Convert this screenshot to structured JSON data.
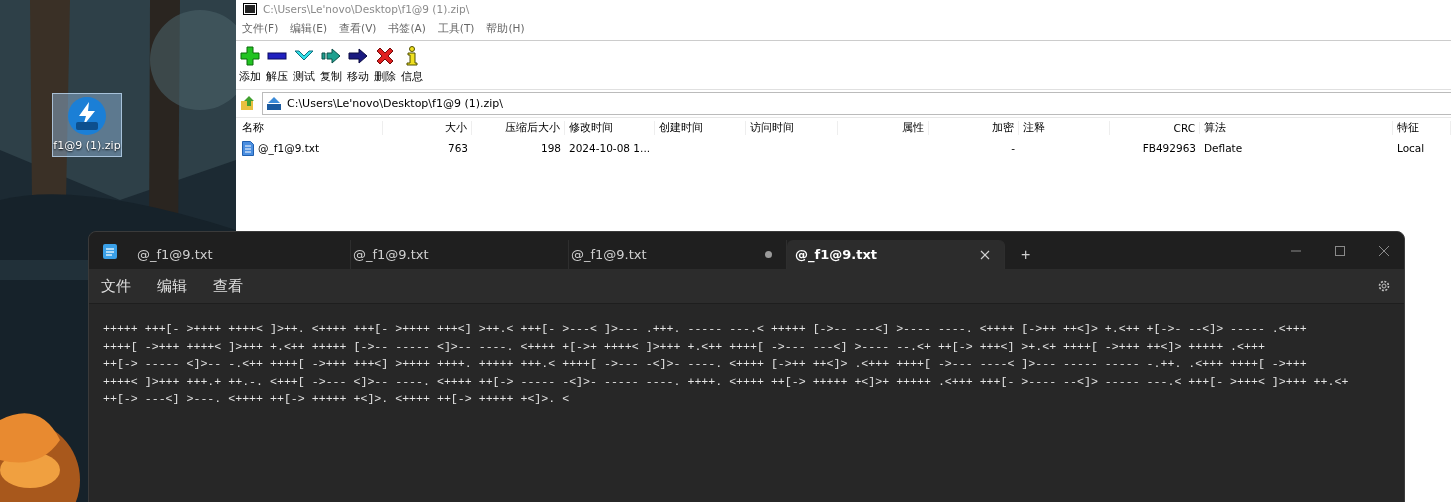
{
  "desktop": {
    "icon": {
      "label": "f1@9 (1).zip",
      "selected": true
    }
  },
  "archive_window": {
    "title": "C:\\Users\\Le'novo\\Desktop\\f1@9 (1).zip\\",
    "menu": [
      "文件(F)",
      "编辑(E)",
      "查看(V)",
      "书签(A)",
      "工具(T)",
      "帮助(H)"
    ],
    "toolbar": [
      {
        "label": "添加",
        "kind": "add"
      },
      {
        "label": "解压",
        "kind": "extract"
      },
      {
        "label": "测试",
        "kind": "test"
      },
      {
        "label": "复制",
        "kind": "copy"
      },
      {
        "label": "移动",
        "kind": "move"
      },
      {
        "label": "删除",
        "kind": "delete"
      },
      {
        "label": "信息",
        "kind": "info"
      }
    ],
    "address": "C:\\Users\\Le'novo\\Desktop\\f1@9 (1).zip\\",
    "columns": [
      "名称",
      "大小",
      "压缩后大小",
      "修改时间",
      "创建时间",
      "访问时间",
      "属性",
      "加密",
      "注释",
      "CRC",
      "算法",
      "特征"
    ],
    "rows": [
      {
        "name": "@_f1@9.txt",
        "size": "763",
        "packed_size": "198",
        "modified": "2024-10-08 1...",
        "encrypted": "-",
        "crc": "FB492963",
        "method": "Deflate",
        "characteristics": "Local"
      }
    ]
  },
  "editor": {
    "tabs": [
      {
        "label": "@_f1@9.txt",
        "selected": false,
        "modified": false
      },
      {
        "label": "@_f1@9.txt",
        "selected": false,
        "modified": false
      },
      {
        "label": "@_f1@9.txt",
        "selected": false,
        "modified": true
      },
      {
        "label": "@_f1@9.txt",
        "selected": true,
        "modified": false
      }
    ],
    "new_tab": "+",
    "menu": [
      "文件",
      "编辑",
      "查看"
    ],
    "lines": [
      "+++++ +++[- >++++ ++++< ]>++. <++++ +++[- >++++ +++<] >++.< +++[- >---< ]>--- .+++. ----- ---.< +++++ [->-- ---<] >---- ----. <++++ [->++ ++<]> +.<++ +[->- --<]> ----- .<+++",
      "++++[ ->+++ ++++< ]>+++ +.<++ +++++ [->-- ----- <]>-- ----. <++++ +[->+ ++++< ]>+++ +.<++ ++++[ ->--- ---<] >---- --.<+ ++[-> +++<] >+.<+ ++++[ ->+++ ++<]> +++++ .<+++",
      "++[-> ----- <]>-- -.<++ ++++[ ->+++ +++<] >++++ ++++. +++++ +++.< ++++[ ->--- -<]>- ----. <++++ [->++ ++<]> .<+++ ++++[ ->--- ----< ]>--- ----- ----- -.++. .<+++ ++++[ ->+++",
      "++++< ]>+++ +++.+ ++.-. <+++[ ->--- <]>-- ----. <++++ ++[-> ----- -<]>- ----- ----. ++++. <++++ ++[-> +++++ +<]>+ +++++ .<+++ +++[- >---- --<]> ----- ---.< +++[- >+++< ]>+++ ++.<+",
      "++[-> ---<] >---. <++++ ++[-> +++++ +<]>. <++++ ++[-> +++++ +<]>. <"
    ]
  }
}
